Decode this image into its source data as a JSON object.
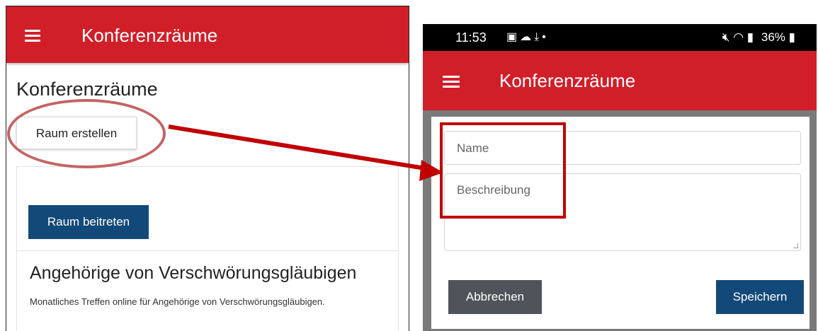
{
  "left": {
    "app_title": "Konferenzräume",
    "page_title": "Konferenzräume",
    "create_button": "Raum erstellen",
    "join_button": "Raum beitreten",
    "card_title": "Angehörige von Verschwörungsgläubigen",
    "card_description": "Monatliches Treffen online für Angehörige von Verschwörungsgläubigen."
  },
  "right": {
    "status": {
      "time": "11:53",
      "icons": [
        "image-icon",
        "cloud-icon",
        "download-icon",
        "dot-icon"
      ],
      "right_icons": [
        "mute-icon",
        "wifi-icon",
        "signal-icon"
      ],
      "battery": "36%"
    },
    "app_title": "Konferenzräume",
    "name_placeholder": "Name",
    "description_placeholder": "Beschreibung",
    "cancel_button": "Abbrechen",
    "save_button": "Speichern"
  },
  "colors": {
    "app_bar": "#d01f29",
    "primary_button": "#134978",
    "secondary_button": "#50545a",
    "annotation": "#c00000",
    "ellipse": "#c46464"
  }
}
